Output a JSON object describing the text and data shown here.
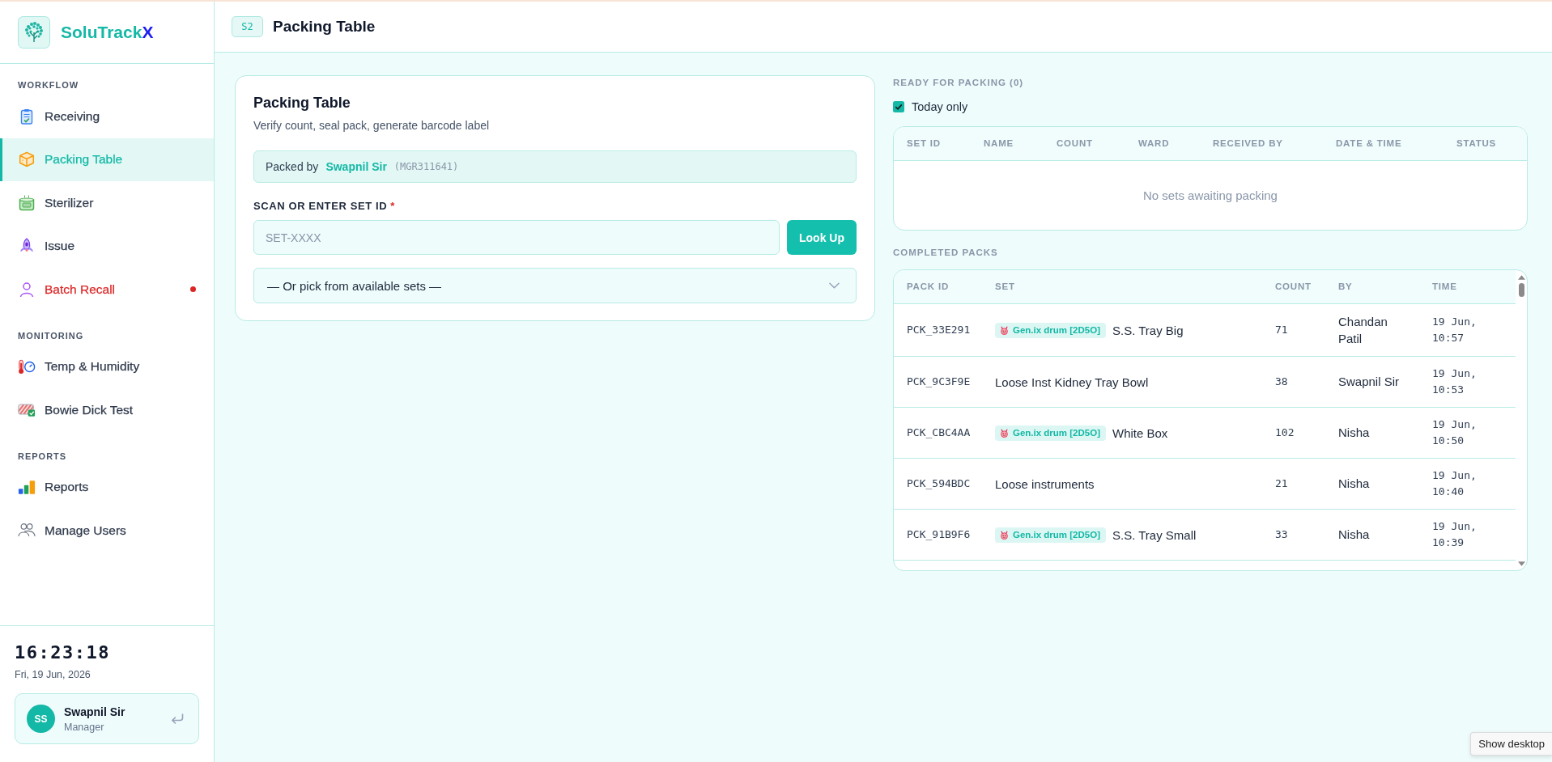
{
  "sidebar": {
    "brand": {
      "name": "SoluTrack",
      "suffix": "X"
    },
    "sections": [
      {
        "title": "WORKFLOW",
        "items": [
          {
            "label": "Receiving",
            "kind": "clipboard",
            "selected": false,
            "alert": false
          },
          {
            "label": "Packing Table",
            "kind": "box",
            "selected": true,
            "alert": false
          },
          {
            "label": "Sterilizer",
            "kind": "pot",
            "selected": false,
            "alert": false
          },
          {
            "label": "Issue",
            "kind": "rocket",
            "selected": false,
            "alert": false
          },
          {
            "label": "Batch Recall",
            "kind": "person",
            "selected": false,
            "alert": true
          }
        ]
      },
      {
        "title": "MONITORING",
        "items": [
          {
            "label": "Temp & Humidity",
            "kind": "thermometer",
            "selected": false,
            "alert": false
          },
          {
            "label": "Bowie Dick Test",
            "kind": "test-sheet",
            "selected": false,
            "alert": false
          }
        ]
      },
      {
        "title": "REPORTS",
        "items": [
          {
            "label": "Reports",
            "kind": "chart",
            "selected": false,
            "alert": false
          },
          {
            "label": "Manage Users",
            "kind": "users",
            "selected": false,
            "alert": false
          }
        ]
      }
    ],
    "clock": {
      "time": "16:23:18",
      "date": "Fri, 19 Jun, 2026"
    },
    "user": {
      "initials": "SS",
      "name": "Swapnil Sir",
      "role": "Manager"
    }
  },
  "header": {
    "badge": "S2",
    "title": "Packing Table"
  },
  "packing_card": {
    "title": "Packing Table",
    "subtitle": "Verify count, seal pack, generate barcode label",
    "packed_by": {
      "label": "Packed by",
      "name": "Swapnil Sir",
      "code": "(MGR311641)"
    },
    "scan_label": "SCAN OR ENTER SET ID",
    "required_mark": "*",
    "input": {
      "placeholder": "SET-XXXX"
    },
    "button": "Look Up",
    "select": {
      "value": "— Or pick from available sets —"
    }
  },
  "ready": {
    "title": "READY FOR PACKING (0)",
    "today_only": {
      "label": "Today only",
      "checked": true
    },
    "columns": [
      "SET ID",
      "NAME",
      "COUNT",
      "WARD",
      "RECEIVED BY",
      "DATE & TIME",
      "STATUS"
    ],
    "empty_message": "No sets awaiting packing"
  },
  "completed": {
    "title": "COMPLETED PACKS",
    "columns": [
      "PACK ID",
      "SET",
      "COUNT",
      "BY",
      "TIME"
    ],
    "rows": [
      {
        "pack_id": "PCK_33E291",
        "tag": "Gen.ix drum [2D5O]",
        "set": "S.S. Tray Big",
        "count": "71",
        "by": "Chandan Patil",
        "time": "19 Jun, 10:57"
      },
      {
        "pack_id": "PCK_9C3F9E",
        "set": "Loose Inst Kidney Tray Bowl",
        "count": "38",
        "by": "Swapnil Sir",
        "time": "19 Jun, 10:53"
      },
      {
        "pack_id": "PCK_CBC4AA",
        "tag": "Gen.ix drum [2D5O]",
        "set": "White Box",
        "count": "102",
        "by": "Nisha",
        "time": "19 Jun, 10:50"
      },
      {
        "pack_id": "PCK_594BDC",
        "set": "Loose instruments",
        "count": "21",
        "by": "Nisha",
        "time": "19 Jun, 10:40"
      },
      {
        "pack_id": "PCK_91B9F6",
        "tag": "Gen.ix drum [2D5O]",
        "set": "S.S. Tray Small",
        "count": "33",
        "by": "Nisha",
        "time": "19 Jun, 10:39"
      }
    ]
  },
  "tooltip": {
    "text": "Show desktop"
  }
}
